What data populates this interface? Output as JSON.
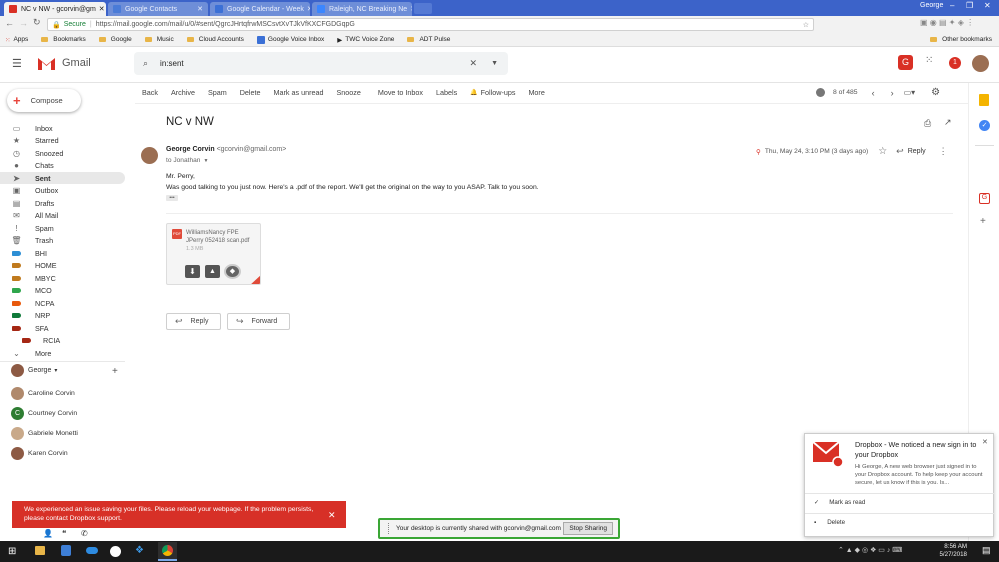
{
  "browser": {
    "tabs": [
      {
        "label": "NC v NW - gcorvin@gm",
        "icon_color": "#d93025"
      },
      {
        "label": "Google Contacts",
        "icon_color": "#4a7bd7"
      },
      {
        "label": "Google Calendar - Week",
        "icon_color": "#3b70d6"
      },
      {
        "label": "Raleigh, NC Breaking Ne",
        "icon_color": "#3a86ff"
      }
    ],
    "user": "George",
    "secure_label": "Secure",
    "url": "https://mail.google.com/mail/u/0/#sent/QgrcJHrtqfrwMSCsvtXvTJkVfKXCFGDGqpG",
    "bookmarks": [
      "Apps",
      "Bookmarks",
      "Google",
      "Music",
      "Cloud Accounts",
      "Google Voice Inbox",
      "TWC Voice Zone",
      "ADT Pulse"
    ],
    "other_bookmarks": "Other bookmarks"
  },
  "gmail": {
    "brand": "Gmail",
    "search_query": "in:sent",
    "notification_count": "1",
    "compose_label": "Compose",
    "nav": [
      {
        "label": "Inbox",
        "icon": "inbox-icon",
        "glyph": "▭"
      },
      {
        "label": "Starred",
        "icon": "star-icon",
        "glyph": "★"
      },
      {
        "label": "Snoozed",
        "icon": "clock-icon",
        "glyph": "◷"
      },
      {
        "label": "Chats",
        "icon": "chat-icon",
        "glyph": "●"
      },
      {
        "label": "Sent",
        "icon": "send-icon",
        "glyph": "➤",
        "active": true
      },
      {
        "label": "Outbox",
        "icon": "outbox-icon",
        "glyph": "▣"
      },
      {
        "label": "Drafts",
        "icon": "draft-icon",
        "glyph": "▤"
      },
      {
        "label": "All Mail",
        "icon": "all-mail-icon",
        "glyph": "✉"
      },
      {
        "label": "Spam",
        "icon": "spam-icon",
        "glyph": "!"
      },
      {
        "label": "Trash",
        "icon": "trash-icon",
        "glyph": "🗑"
      },
      {
        "label": "BHI",
        "color": "#2d8fd5"
      },
      {
        "label": "HOME",
        "color": "#c07a1e"
      },
      {
        "label": "MBYC",
        "color": "#c07a1e"
      },
      {
        "label": "MCO",
        "color": "#2fa64c"
      },
      {
        "label": "NCPA",
        "color": "#e8590c"
      },
      {
        "label": "NRP",
        "color": "#0f7a3a"
      },
      {
        "label": "SFA",
        "color": "#a52714"
      },
      {
        "label": "RCIA",
        "color": "#a52714",
        "indent": true
      },
      {
        "label": "More",
        "icon": "chevron-down-icon",
        "glyph": "⌄"
      }
    ],
    "hangouts_user": "George",
    "contacts": [
      {
        "name": "Caroline Corvin",
        "color": "#b0896c",
        "initial": ""
      },
      {
        "name": "Courtney Corvin",
        "color": "#2e7d32",
        "initial": "C"
      },
      {
        "name": "Gabriele Monetti",
        "color": "#c9a98a",
        "initial": ""
      },
      {
        "name": "Karen Corvin",
        "color": "#8d5a44",
        "initial": ""
      }
    ],
    "actions": [
      "Back",
      "Archive",
      "Spam",
      "Delete",
      "Mark as unread",
      "Snooze",
      "Move to Inbox",
      "Labels",
      "Follow-ups",
      "More"
    ],
    "pagination": "8 of 485",
    "subject": "NC v NW",
    "message": {
      "sender_name": "George Corvin",
      "sender_email": "<gcorvin@gmail.com>",
      "to": "to Jonathan",
      "date": "Thu, May 24, 3:10 PM (3 days ago)",
      "reply_label": "Reply",
      "greeting": "Mr. Perry,",
      "body": "Was good talking to you just now.  Here's a .pdf of the report.  We'll get the  original on the way to you ASAP.  Talk to you soon.",
      "ellipsis": "•••"
    },
    "attachment": {
      "badge": "PDF",
      "name_line1": "WilliamsNancy FPE",
      "name_line2": "JPerry 052418 scan.pdf",
      "size": "1.3 MB"
    },
    "reply_button": "Reply",
    "forward_button": "Forward"
  },
  "dropbox_error": "We experienced an issue saving your files. Please reload your webpage. If the problem persists, please contact Dropbox support.",
  "share_bar": {
    "text": "Your desktop is currently shared with gcorvin@gmail.com",
    "button": "Stop Sharing"
  },
  "notification": {
    "title": "Dropbox - We noticed a new sign in to your Dropbox",
    "body": "Hi George, A new web browser just signed in to your Dropbox account. To help keep your account secure, let us know if this is you. Is...",
    "action1": "Mark as read",
    "action2": "Delete"
  },
  "taskbar": {
    "time": "8:56 AM",
    "date": "5/27/2018"
  },
  "colors": {
    "chrome_blue": "#3c63c9",
    "gmail_red": "#d93025",
    "error_red": "#d73027",
    "share_green": "#3aa635"
  }
}
